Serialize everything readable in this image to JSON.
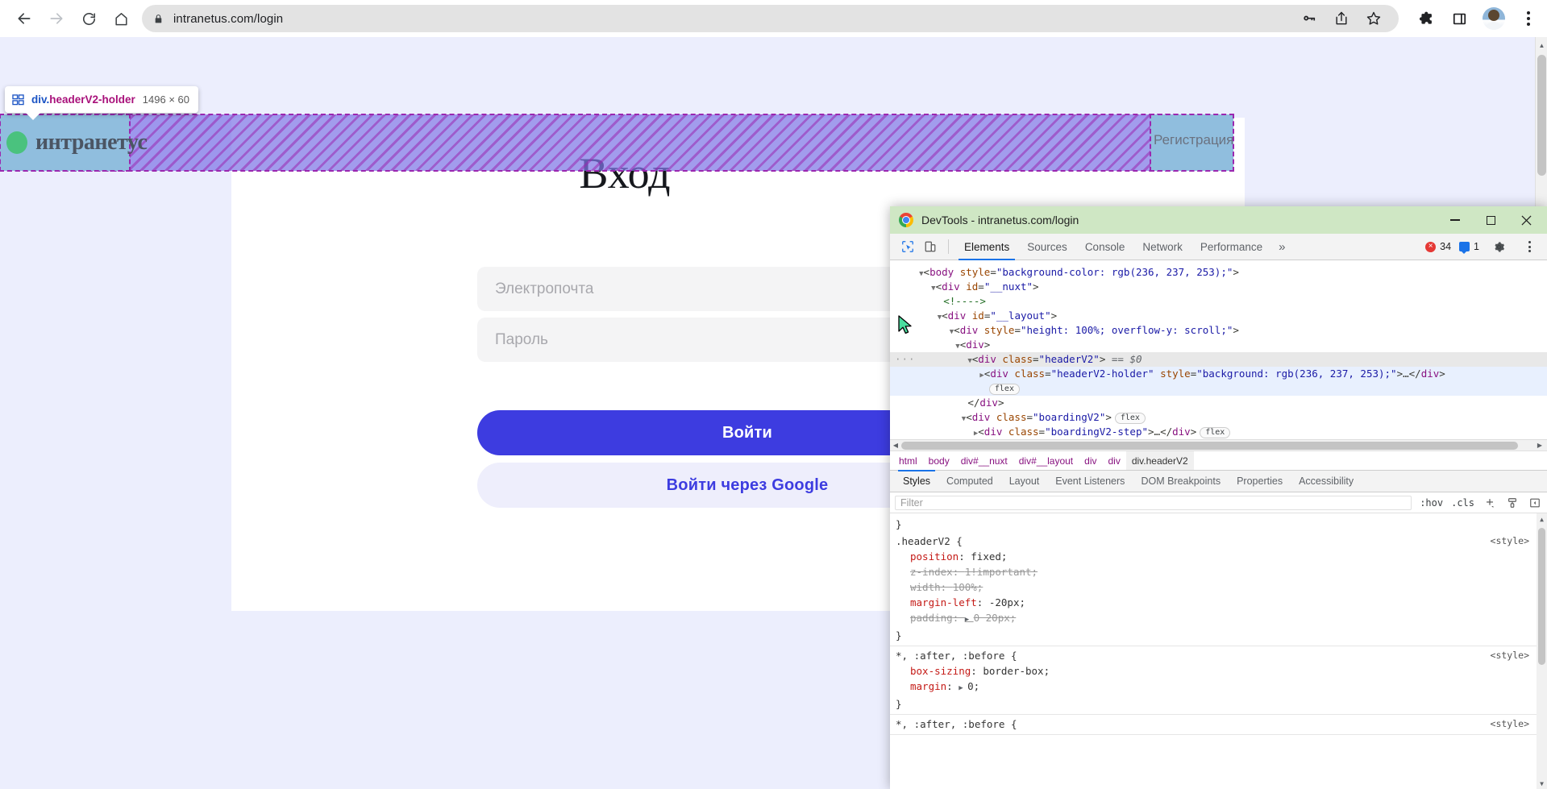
{
  "browser": {
    "url": "intranetus.com/login",
    "nav": {
      "back": "back-arrow",
      "forward": "forward-arrow",
      "reload": "reload",
      "home": "home"
    },
    "omnibox_icons": [
      "key-icon",
      "share-icon",
      "bookmark-star-icon"
    ],
    "toolbar_icons": [
      "extensions-puzzle-icon",
      "side-panel-icon",
      "profile-avatar",
      "chrome-menu-kebab"
    ]
  },
  "inspector_tooltip": {
    "selector_prefix": "div.",
    "selector_class": "headerV2-holder",
    "dimensions": "1496 × 60"
  },
  "page": {
    "background": "#eceefd",
    "header": {
      "logo_text": "интранетус",
      "register_link": "Регистрация"
    },
    "title": "Вход",
    "fields": [
      {
        "name": "email",
        "placeholder": "Электропочта",
        "value": ""
      },
      {
        "name": "password",
        "placeholder": "Пароль",
        "value": ""
      }
    ],
    "primary_button": "Войти",
    "secondary_button": "Войти через Google",
    "colors": {
      "primary": "#3d3ce0",
      "secondary_bg": "#eeeefc",
      "field_bg": "#f4f4f5"
    }
  },
  "devtools": {
    "window_title": "DevTools - intranetus.com/login",
    "window_buttons": [
      "minimize",
      "maximize",
      "close"
    ],
    "toolbar_icons": [
      "inspect-element-icon",
      "device-toolbar-icon"
    ],
    "tabs": [
      {
        "label": "Elements",
        "selected": true
      },
      {
        "label": "Sources",
        "selected": false
      },
      {
        "label": "Console",
        "selected": false
      },
      {
        "label": "Network",
        "selected": false
      },
      {
        "label": "Performance",
        "selected": false
      }
    ],
    "more_tabs": "»",
    "error_count": "34",
    "message_count": "1",
    "settings_icon": "gear-icon",
    "menu_icon": "kebab-icon",
    "dom": {
      "lines": [
        {
          "indent": 1,
          "state": "none",
          "parts": [
            {
              "t": "tri",
              "v": "▼"
            },
            {
              "t": "punct",
              "v": "<"
            },
            {
              "t": "tag",
              "v": "body"
            },
            {
              "t": "punct",
              "v": " "
            },
            {
              "t": "attr",
              "v": "style"
            },
            {
              "t": "punct",
              "v": "="
            },
            {
              "t": "val",
              "v": "\"background-color: rgb(236, 237, 253);\""
            },
            {
              "t": "punct",
              "v": ">"
            }
          ]
        },
        {
          "indent": 2,
          "state": "none",
          "parts": [
            {
              "t": "tri",
              "v": "▼"
            },
            {
              "t": "punct",
              "v": "<"
            },
            {
              "t": "tag",
              "v": "div"
            },
            {
              "t": "punct",
              "v": " "
            },
            {
              "t": "attr",
              "v": "id"
            },
            {
              "t": "punct",
              "v": "="
            },
            {
              "t": "val",
              "v": "\"__nuxt\""
            },
            {
              "t": "punct",
              "v": ">"
            }
          ]
        },
        {
          "indent": 3,
          "state": "none",
          "parts": [
            {
              "t": "comment",
              "v": "<!---->"
            }
          ]
        },
        {
          "indent": 2.6,
          "state": "none",
          "parts": [
            {
              "t": "tri",
              "v": "▼"
            },
            {
              "t": "punct",
              "v": "<"
            },
            {
              "t": "tag",
              "v": "div"
            },
            {
              "t": "punct",
              "v": " "
            },
            {
              "t": "attr",
              "v": "id"
            },
            {
              "t": "punct",
              "v": "="
            },
            {
              "t": "val",
              "v": "\"__layout\""
            },
            {
              "t": "punct",
              "v": ">"
            }
          ]
        },
        {
          "indent": 3.4,
          "state": "none",
          "parts": [
            {
              "t": "tri",
              "v": "▼"
            },
            {
              "t": "punct",
              "v": "<"
            },
            {
              "t": "tag",
              "v": "div"
            },
            {
              "t": "punct",
              "v": " "
            },
            {
              "t": "attr",
              "v": "style"
            },
            {
              "t": "punct",
              "v": "="
            },
            {
              "t": "val",
              "v": "\"height: 100%; overflow-y: scroll;\""
            },
            {
              "t": "punct",
              "v": ">"
            }
          ]
        },
        {
          "indent": 4.2,
          "state": "none",
          "parts": [
            {
              "t": "tri",
              "v": "▼"
            },
            {
              "t": "punct",
              "v": "<"
            },
            {
              "t": "tag",
              "v": "div"
            },
            {
              "t": "punct",
              "v": ">"
            }
          ]
        },
        {
          "indent": 5,
          "state": "sel-gray",
          "dots": true,
          "parts": [
            {
              "t": "tri",
              "v": "▼"
            },
            {
              "t": "punct",
              "v": "<"
            },
            {
              "t": "tag",
              "v": "div"
            },
            {
              "t": "punct",
              "v": " "
            },
            {
              "t": "attr",
              "v": "class"
            },
            {
              "t": "punct",
              "v": "="
            },
            {
              "t": "val",
              "v": "\"headerV2\""
            },
            {
              "t": "punct",
              "v": "> "
            },
            {
              "t": "dollar",
              "v": "== $0"
            }
          ]
        },
        {
          "indent": 5.8,
          "state": "sel-blue",
          "parts": [
            {
              "t": "tri",
              "v": "▶"
            },
            {
              "t": "punct",
              "v": "<"
            },
            {
              "t": "tag",
              "v": "div"
            },
            {
              "t": "punct",
              "v": " "
            },
            {
              "t": "attr",
              "v": "class"
            },
            {
              "t": "punct",
              "v": "="
            },
            {
              "t": "val",
              "v": "\"headerV2-holder\""
            },
            {
              "t": "punct",
              "v": " "
            },
            {
              "t": "attr",
              "v": "style"
            },
            {
              "t": "punct",
              "v": "="
            },
            {
              "t": "val",
              "v": "\"background: rgb(236, 237, 253);\""
            },
            {
              "t": "punct",
              "v": ">…</"
            },
            {
              "t": "tag",
              "v": "div"
            },
            {
              "t": "punct",
              "v": ">"
            }
          ]
        },
        {
          "indent": 6.4,
          "state": "sel-blue",
          "badge": "flex",
          "parts": []
        },
        {
          "indent": 5,
          "state": "none",
          "parts": [
            {
              "t": "punct",
              "v": "</"
            },
            {
              "t": "tag",
              "v": "div"
            },
            {
              "t": "punct",
              "v": ">"
            }
          ]
        },
        {
          "indent": 4.5,
          "state": "none",
          "badge": "flex",
          "parts": [
            {
              "t": "tri",
              "v": "▼"
            },
            {
              "t": "punct",
              "v": "<"
            },
            {
              "t": "tag",
              "v": "div"
            },
            {
              "t": "punct",
              "v": " "
            },
            {
              "t": "attr",
              "v": "class"
            },
            {
              "t": "punct",
              "v": "="
            },
            {
              "t": "val",
              "v": "\"boardingV2\""
            },
            {
              "t": "punct",
              "v": ">"
            }
          ]
        },
        {
          "indent": 5.3,
          "state": "none",
          "badge": "flex",
          "parts": [
            {
              "t": "tri",
              "v": "▶"
            },
            {
              "t": "punct",
              "v": "<"
            },
            {
              "t": "tag",
              "v": "div"
            },
            {
              "t": "punct",
              "v": " "
            },
            {
              "t": "attr",
              "v": "class"
            },
            {
              "t": "punct",
              "v": "="
            },
            {
              "t": "val",
              "v": "\"boardingV2-step\""
            },
            {
              "t": "punct",
              "v": ">…</"
            },
            {
              "t": "tag",
              "v": "div"
            },
            {
              "t": "punct",
              "v": ">"
            }
          ]
        },
        {
          "indent": 4.7,
          "state": "none",
          "parts": [
            {
              "t": "punct",
              "v": "</"
            },
            {
              "t": "tag",
              "v": "div"
            },
            {
              "t": "punct",
              "v": ">"
            }
          ]
        }
      ]
    },
    "breadcrumb": [
      "html",
      "body",
      "div#__nuxt",
      "div#__layout",
      "div",
      "div",
      "div.headerV2"
    ],
    "breadcrumb_active": "div.headerV2",
    "sidebar_tabs": [
      {
        "label": "Styles",
        "selected": true
      },
      {
        "label": "Computed",
        "selected": false
      },
      {
        "label": "Layout",
        "selected": false
      },
      {
        "label": "Event Listeners",
        "selected": false
      },
      {
        "label": "DOM Breakpoints",
        "selected": false
      },
      {
        "label": "Properties",
        "selected": false
      },
      {
        "label": "Accessibility",
        "selected": false
      }
    ],
    "filter": {
      "placeholder": "Filter",
      "value": ""
    },
    "filter_tools": [
      ":hov",
      ".cls"
    ],
    "filter_icons": [
      "add-rule-plus-icon",
      "style-pane-icon",
      "toggle-sidebar-icon"
    ],
    "styles": {
      "top_orphan_brace": "}",
      "rules": [
        {
          "selector": ".headerV2 {",
          "source": "<style>",
          "declarations": [
            {
              "prop": "position",
              "value": "fixed;",
              "disabled": false,
              "expandable": false
            },
            {
              "prop": "z-index",
              "value": "1!important;",
              "disabled": true,
              "expandable": false
            },
            {
              "prop": "width",
              "value": "100%;",
              "disabled": true,
              "expandable": false
            },
            {
              "prop": "margin-left",
              "value": "-20px;",
              "disabled": false,
              "expandable": false
            },
            {
              "prop": "padding",
              "value": "0 20px;",
              "disabled": true,
              "expandable": true
            }
          ],
          "close": "}"
        },
        {
          "selector": "*, :after, :before {",
          "source": "<style>",
          "declarations": [
            {
              "prop": "box-sizing",
              "value": "border-box;",
              "disabled": false,
              "expandable": false
            },
            {
              "prop": "margin",
              "value": "0;",
              "disabled": false,
              "expandable": true
            }
          ],
          "close": "}"
        },
        {
          "selector": "*, :after, :before {",
          "source": "<style>",
          "declarations": [],
          "close": ""
        }
      ]
    }
  }
}
